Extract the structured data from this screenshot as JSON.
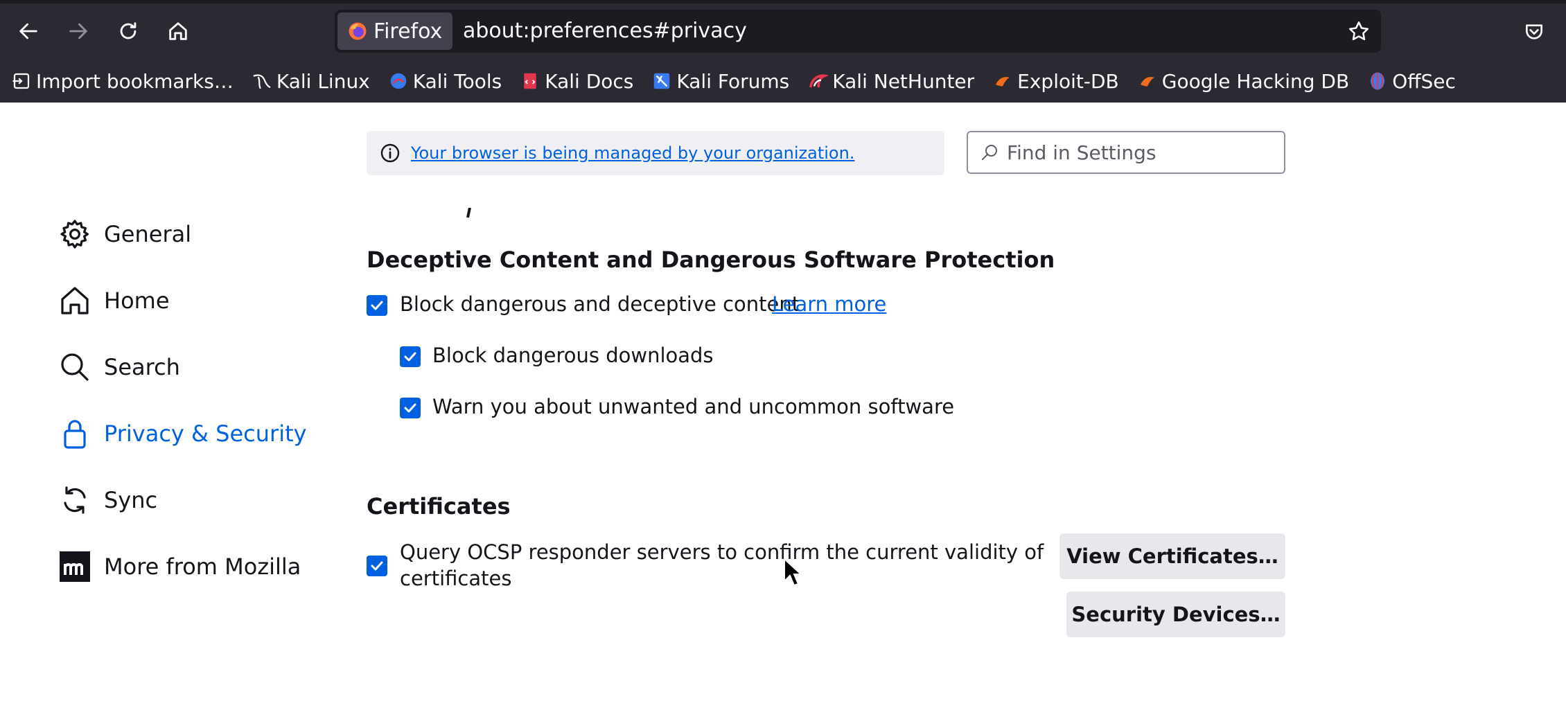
{
  "browser": {
    "identity_label": "Firefox",
    "url": "about:preferences#privacy",
    "bookmarks": [
      {
        "label": "Import bookmarks…",
        "icon": "import-icon"
      },
      {
        "label": "Kali Linux",
        "icon": "kali-dragon-icon"
      },
      {
        "label": "Kali Tools",
        "icon": "kali-tools-icon"
      },
      {
        "label": "Kali Docs",
        "icon": "kali-docs-icon"
      },
      {
        "label": "Kali Forums",
        "icon": "kali-forums-icon"
      },
      {
        "label": "Kali NetHunter",
        "icon": "kali-nethunter-icon"
      },
      {
        "label": "Exploit-DB",
        "icon": "exploit-db-icon"
      },
      {
        "label": "Google Hacking DB",
        "icon": "ghdb-icon"
      },
      {
        "label": "OffSec",
        "icon": "offsec-icon"
      }
    ]
  },
  "page": {
    "managed_notice": "Your browser is being managed by your organization.",
    "search_placeholder": "Find in Settings"
  },
  "sidebar": {
    "items": [
      {
        "label": "General",
        "icon": "gear-icon"
      },
      {
        "label": "Home",
        "icon": "home-icon"
      },
      {
        "label": "Search",
        "icon": "search-icon"
      },
      {
        "label": "Privacy & Security",
        "icon": "lock-icon",
        "selected": true
      },
      {
        "label": "Sync",
        "icon": "sync-icon"
      },
      {
        "label": "More from Mozilla",
        "icon": "mozilla-icon"
      }
    ]
  },
  "deceptive": {
    "heading": "Deceptive Content and Dangerous Software Protection",
    "block_dangerous": {
      "label": "Block dangerous and deceptive content",
      "checked": true
    },
    "learn_more": "Learn more",
    "block_downloads": {
      "label": "Block dangerous downloads",
      "checked": true
    },
    "warn_unwanted": {
      "label": "Warn you about unwanted and uncommon software",
      "checked": true
    }
  },
  "certificates": {
    "heading": "Certificates",
    "ocsp": {
      "label_line1": "Query OCSP responder servers to confirm the current validity of",
      "label_line2": "certificates",
      "checked": true
    },
    "view_button": "View Certificates…",
    "devices_button": "Security Devices…"
  },
  "colors": {
    "accent": "#0061e0",
    "chrome_bg": "#2b2a33",
    "urlbar_bg": "#1c1b22"
  }
}
